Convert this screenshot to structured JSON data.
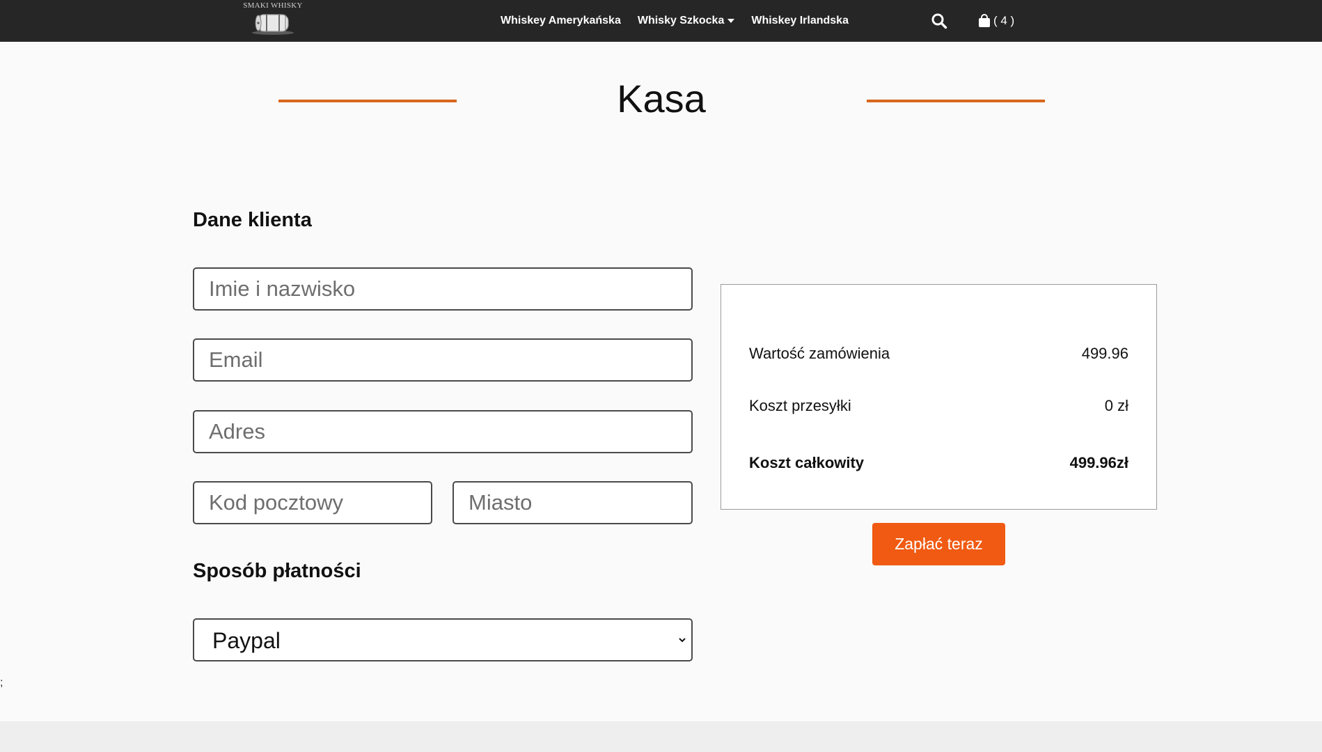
{
  "header": {
    "logo_text": "SMAKI WHISKY",
    "nav_items": [
      {
        "label": "Whiskey Amerykańska"
      },
      {
        "label": "Whisky Szkocka"
      },
      {
        "label": "Whiskey Irlandska"
      }
    ],
    "cart_count": "( 4 )"
  },
  "page": {
    "title": "Kasa"
  },
  "customer": {
    "heading": "Dane klienta",
    "name_placeholder": "Imie i nazwisko",
    "email_placeholder": "Email",
    "address_placeholder": "Adres",
    "postal_placeholder": "Kod pocztowy",
    "city_placeholder": "Miasto"
  },
  "payment": {
    "heading": "Sposób płatności",
    "selected": "Paypal"
  },
  "summary": {
    "order_value_label": "Wartość zamówienia",
    "order_value": "499.96",
    "shipping_label": "Koszt przesyłki",
    "shipping_value": "0 zł",
    "total_label": "Koszt całkowity",
    "total_value": "499.96zł"
  },
  "pay_button": "Zapłać teraz",
  "stray_text": ";",
  "colors": {
    "accent": "#f05a12",
    "title_line": "#d8661c",
    "navbar": "#262626"
  },
  "icons": {
    "search": "search-icon",
    "cart": "shopping-bag-icon",
    "dropdown": "chevron-down-icon"
  }
}
